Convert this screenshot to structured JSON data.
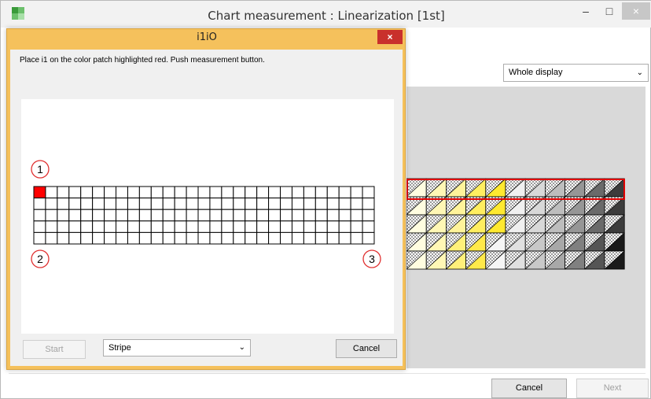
{
  "main_window": {
    "title": "Chart measurement : Linearization [1st]",
    "minimize_glyph": "–",
    "maximize_glyph": "□",
    "close_glyph": "×",
    "display_select": {
      "value": "Whole display",
      "chevron": "⌄"
    },
    "buttons": {
      "cancel": "Cancel",
      "next": "Next"
    },
    "preview": {
      "rows": 5,
      "highlight_row": 0,
      "columns": [
        {
          "top": "#fffde0",
          "bottom": "#fffde0"
        },
        {
          "top": "#fff7b5",
          "bottom": "#fff7b5"
        },
        {
          "top": "#fff39a",
          "bottom": "#fff07a"
        },
        {
          "top": "#ffee60",
          "bottom": "#ffe94a"
        },
        {
          "top": "#ffe930",
          "bottom": "#f5f5f5"
        },
        {
          "top": "#f0f0f0",
          "bottom": "#e0e0e0"
        },
        {
          "top": "#d8d8d8",
          "bottom": "#c8c8c8"
        },
        {
          "top": "#bdbdbd",
          "bottom": "#a8a8a8"
        },
        {
          "top": "#969696",
          "bottom": "#808080"
        },
        {
          "top": "#6a6a6a",
          "bottom": "#555555"
        },
        {
          "top": "#3c3c3c",
          "bottom": "#1a1a1a"
        }
      ]
    }
  },
  "dialog": {
    "title": "i1iO",
    "close_glyph": "×",
    "instruction": "Place i1 on the color patch highlighted red. Push measurement button.",
    "grid": {
      "cols": 29,
      "rows": 5,
      "active_row": 0,
      "active_col": 0,
      "active_color": "#ff0000"
    },
    "markers": {
      "m1": "1",
      "m2": "2",
      "m3": "3"
    },
    "buttons": {
      "start": "Start",
      "cancel": "Cancel"
    },
    "mode_select": {
      "value": "Stripe",
      "chevron": "⌄"
    }
  },
  "colors": {
    "dialog_frame": "#f5c15c",
    "highlight": "#e10000",
    "dialog_close": "#c9302c"
  }
}
